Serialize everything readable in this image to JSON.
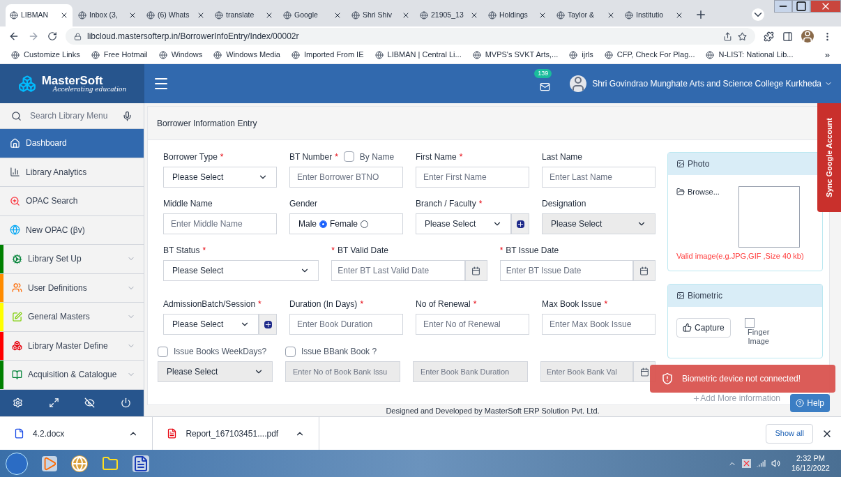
{
  "browser": {
    "tabs": [
      {
        "title": "LIBMAN",
        "selected": true
      },
      {
        "title": "Inbox (3,",
        "selected": false
      },
      {
        "title": "(6) Whats",
        "selected": false
      },
      {
        "title": "translate",
        "selected": false
      },
      {
        "title": "Google",
        "selected": false
      },
      {
        "title": "Shri Shiv",
        "selected": false
      },
      {
        "title": "21905_13",
        "selected": false
      },
      {
        "title": "Holdings",
        "selected": false
      },
      {
        "title": "Taylor &",
        "selected": false
      },
      {
        "title": "Institutio",
        "selected": false
      }
    ],
    "address": "libcloud.mastersofterp.in/BorrowerInfoEntry/Index/00002r",
    "bookmarks": [
      "Customize Links",
      "Free Hotmail",
      "Windows",
      "Windows Media",
      "Imported From IE",
      "LIBMAN | Central Li...",
      "MVPS's SVKT Arts,...",
      "ijrls",
      "CFP, Check For Plag...",
      "N-LIST: National Lib..."
    ],
    "bookmarks_more": "»"
  },
  "app": {
    "logo": {
      "name": "MasterSoft",
      "tagline": "Accelerating education"
    },
    "notifications": "139",
    "college": "Shri Govindrao Munghate Arts and Science College Kurkheda",
    "search": {
      "placeholder": "Search Library Menu"
    },
    "menu": [
      {
        "label": "Dashboard",
        "selected": true,
        "expandable": false
      },
      {
        "label": "Library Analytics",
        "selected": false,
        "expandable": false
      },
      {
        "label": "OPAC Search",
        "selected": false,
        "expandable": false
      },
      {
        "label": "New OPAC (βv)",
        "selected": false,
        "expandable": false
      },
      {
        "label": "Library Set Up",
        "selected": false,
        "expandable": true,
        "color": "#008000"
      },
      {
        "label": "User Definitions",
        "selected": false,
        "expandable": true,
        "color": "#ff8c00"
      },
      {
        "label": "General Masters",
        "selected": false,
        "expandable": true,
        "color": "#ffff00"
      },
      {
        "label": "Library Master Define",
        "selected": false,
        "expandable": true,
        "color": "#ff0000"
      },
      {
        "label": "Acquisition & Catalogue",
        "selected": false,
        "expandable": true,
        "color": "#008000"
      }
    ],
    "page_title": "Borrower Information Entry",
    "form_rows": [
      [
        {
          "kind": "select",
          "label": "Borrower Type",
          "mark": {
            "text": "*",
            "before": false
          },
          "value": "Please Select",
          "disabled": false
        },
        {
          "kind": "input",
          "label": "BT Number",
          "mark": {
            "text": "*",
            "before": false
          },
          "placeholder": "Enter Borrower BTNO",
          "disabled": false,
          "option": {
            "label": "By Name",
            "checked": false
          }
        },
        {
          "kind": "input",
          "label": "First Name",
          "mark": {
            "text": "*",
            "before": false
          },
          "placeholder": "Enter First Name",
          "disabled": false
        },
        {
          "kind": "input",
          "label": "Last Name",
          "placeholder": "Enter Last Name",
          "disabled": false
        }
      ],
      [
        {
          "kind": "input",
          "label": "Middle Name",
          "placeholder": "Enter Middle Name",
          "disabled": false
        },
        {
          "kind": "radio",
          "label": "Gender",
          "options": [
            {
              "label": "Male",
              "selected": true
            },
            {
              "label": "Female",
              "selected": false
            }
          ]
        },
        {
          "kind": "select_add",
          "label": "Branch / Faculty",
          "mark": {
            "text": "*",
            "before": false
          },
          "value": "Please Select",
          "disabled": false
        },
        {
          "kind": "select",
          "label": "Designation",
          "value": "Please Select",
          "disabled": true
        }
      ],
      [
        {
          "kind": "select",
          "label": "BT Status",
          "mark": {
            "text": "*",
            "before": false
          },
          "value": "Please Select",
          "disabled": false
        },
        {
          "kind": "date",
          "label": "BT Valid Date",
          "mark": {
            "text": "*",
            "before": true
          },
          "placeholder": "Enter BT Last Valid Date",
          "disabled": false
        },
        {
          "kind": "date",
          "label": "BT Issue Date",
          "mark": {
            "text": "*",
            "before": true
          },
          "placeholder": "Enter BT Issue Date",
          "disabled": false
        }
      ],
      [
        {
          "kind": "select_add",
          "label": "AdmissionBatch/Session",
          "mark": {
            "text": "*",
            "before": false
          },
          "value": "Please Select",
          "disabled": false
        },
        {
          "kind": "input",
          "label": "Duration (In Days)",
          "mark": {
            "text": "*",
            "before": false
          },
          "placeholder": "Enter Book Duration",
          "disabled": false
        },
        {
          "kind": "input",
          "label": "No of Renewal",
          "mark": {
            "text": "*",
            "before": false
          },
          "placeholder": "Enter No of Renewal",
          "disabled": false
        },
        {
          "kind": "input",
          "label": "Max Book Issue",
          "mark": {
            "text": "*",
            "before": false
          },
          "placeholder": "Enter Max Book Issue",
          "disabled": false
        }
      ],
      [
        {
          "kind": "checkbox",
          "label": "Issue Books WeekDays?",
          "checked": false
        },
        {
          "kind": "checkbox",
          "label": "Issue BBank Book ?",
          "checked": false
        }
      ],
      [
        {
          "kind": "select",
          "value": "Please Select",
          "disabled": true
        },
        {
          "kind": "input",
          "placeholder": "Enter No of Book Bank Issu",
          "disabled": true
        },
        {
          "kind": "input",
          "placeholder": "Enter Book Bank Duration",
          "disabled": true
        },
        {
          "kind": "date",
          "placeholder": "Enter Book Bank Val",
          "disabled": true
        }
      ]
    ],
    "photo": {
      "title": "Photo",
      "browse": "Browse...",
      "note": "Valid image(e.g.JPG,GIF ,Size 40 kb)"
    },
    "biometric": {
      "title": "Biometric",
      "capture": "Capture",
      "finger": {
        "label": "Finger Image",
        "checked": false
      }
    },
    "add_more": "Add More information",
    "help": "Help",
    "sync": "Sync Google Account",
    "toast": "Biometric device not connected!",
    "footer": "Designed and Developed by MasterSoft ERP Solution Pvt. Ltd."
  },
  "downloads": {
    "files": [
      {
        "name": "4.2.docx",
        "kind": "word"
      },
      {
        "name": "Report_167103451....pdf",
        "kind": "pdf"
      }
    ],
    "show_all": "Show all"
  },
  "taskbar": {
    "time": "2:32 PM",
    "date": "16/12/2022"
  }
}
